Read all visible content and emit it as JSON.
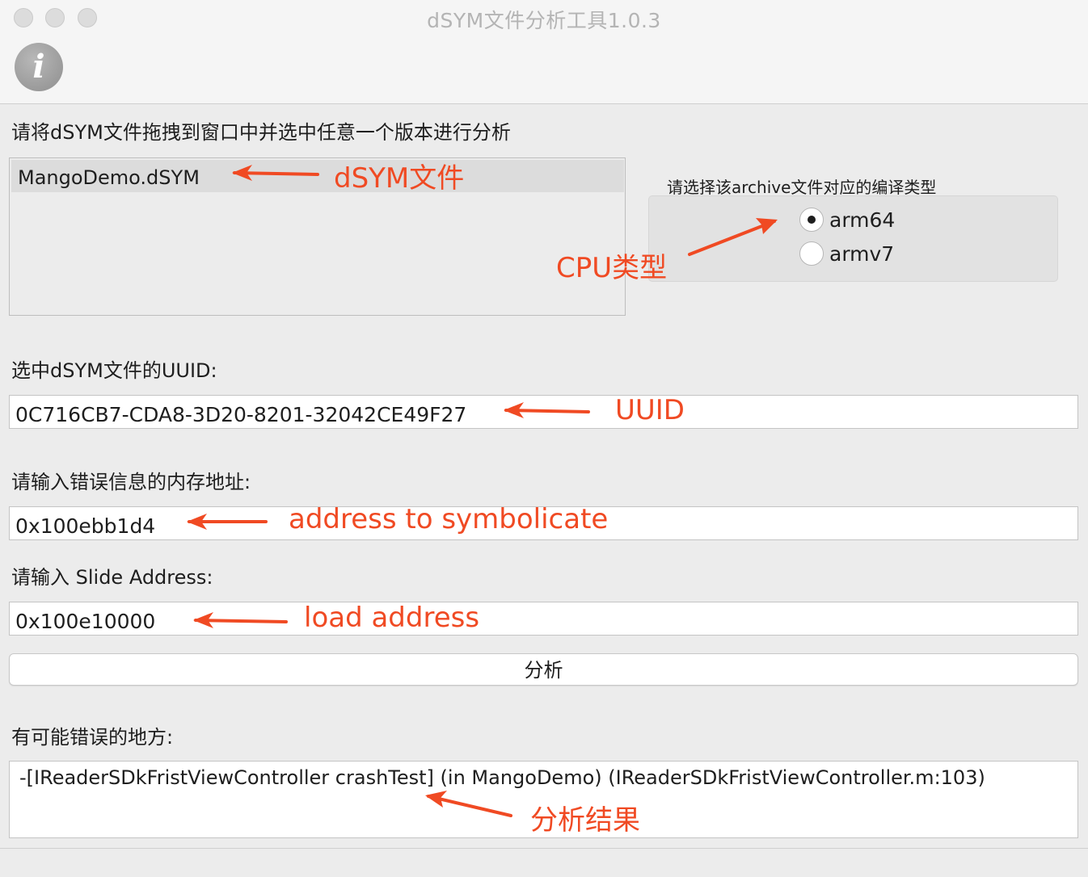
{
  "window": {
    "title": "dSYM文件分析工具1.0.3"
  },
  "toolbar": {
    "info_glyph": "i"
  },
  "instructions": "请将dSYM文件拖拽到窗口中并选中任意一个版本进行分析",
  "file_list": {
    "items": [
      "MangoDemo.dSYM"
    ]
  },
  "cpu": {
    "label": "请选择该archive文件对应的编译类型",
    "options": [
      "arm64",
      "armv7"
    ],
    "selected": "arm64"
  },
  "uuid": {
    "label": "选中dSYM文件的UUID:",
    "value": "0C716CB7-CDA8-3D20-8201-32042CE49F27"
  },
  "memory_address": {
    "label": "请输入错误信息的内存地址:",
    "value": "0x100ebb1d4"
  },
  "slide_address": {
    "label": "请输入 Slide Address:",
    "value": "0x100e10000"
  },
  "analyze_button": "分析",
  "result": {
    "label": "有可能错误的地方:",
    "value": "-[IReaderSDkFristViewController crashTest] (in MangoDemo) (IReaderSDkFristViewController.m:103)"
  },
  "annotations": {
    "dsym": "dSYM文件",
    "cpu": "CPU类型",
    "uuid": "UUID",
    "address": "address to symbolicate",
    "load": "load address",
    "result": "分析结果"
  },
  "colors": {
    "annotation": "#f04a23",
    "window_bg": "#ececec"
  },
  "icons": [
    "close-icon",
    "minimize-icon",
    "zoom-icon",
    "info-icon"
  ]
}
